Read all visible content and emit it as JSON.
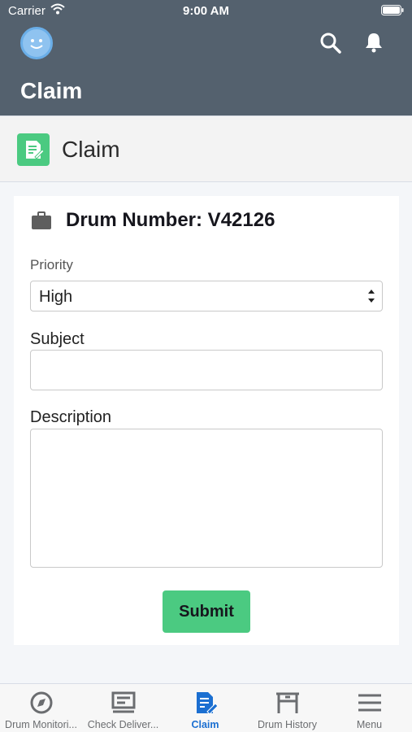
{
  "status_bar": {
    "carrier": "Carrier",
    "time": "9:00 AM"
  },
  "header": {
    "title": "Claim",
    "avatar_icon": "smiley-icon",
    "search_icon": "search-icon",
    "notifications_icon": "bell-icon"
  },
  "sub_header": {
    "title": "Claim",
    "icon": "claim-document-icon"
  },
  "card": {
    "title": "Drum Number: V42126",
    "icon": "briefcase-icon",
    "priority": {
      "label": "Priority",
      "value": "High"
    },
    "subject": {
      "label": "Subject",
      "value": ""
    },
    "description": {
      "label": "Description",
      "value": ""
    },
    "submit_label": "Submit"
  },
  "tabs": [
    {
      "label": "Drum Monitori...",
      "icon": "compass-icon",
      "active": false
    },
    {
      "label": "Check Deliver...",
      "icon": "list-icon",
      "active": false
    },
    {
      "label": "Claim",
      "icon": "claim-icon",
      "active": true
    },
    {
      "label": "Drum History",
      "icon": "table-icon",
      "active": false
    },
    {
      "label": "Menu",
      "icon": "hamburger-icon",
      "active": false
    }
  ],
  "colors": {
    "header_bg": "#54616e",
    "accent_green": "#4bca81",
    "active_tab": "#1b6fd1"
  }
}
